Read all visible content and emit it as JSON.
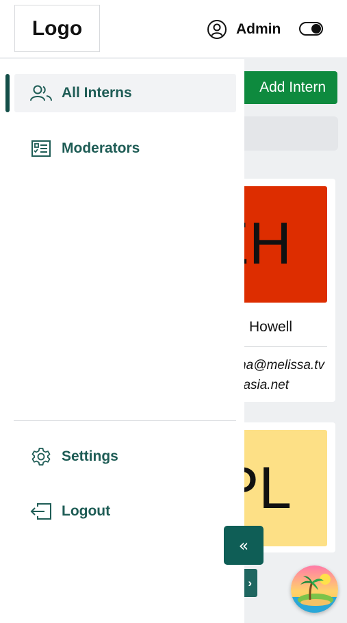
{
  "header": {
    "logo_text": "Logo",
    "user_icon": "user-circle-icon",
    "user_name": "Admin",
    "theme_toggle_icon": "toggle-icon"
  },
  "main": {
    "add_button_label": "Add Intern",
    "cards": [
      {
        "initials": "EH",
        "avatar_color": "#dd2d00",
        "name": "Ervin Howell",
        "email_line1": "Shanna@melissa.tv",
        "email_line2": "Anastasia.net"
      },
      {
        "initials": "PL",
        "avatar_color": "#fde086"
      }
    ],
    "next_page_icon": "chevron-right-icon"
  },
  "sidebar": {
    "items": [
      {
        "label": "All Interns",
        "icon": "users-icon",
        "active": true
      },
      {
        "label": "Moderators",
        "icon": "id-card-icon",
        "active": false
      }
    ],
    "bottom_items": [
      {
        "label": "Settings",
        "icon": "gear-icon"
      },
      {
        "label": "Logout",
        "icon": "logout-icon"
      }
    ],
    "collapse_label": "«",
    "collapse_icon": "double-chevron-left-icon"
  },
  "floating": {
    "icon": "beach-island-icon"
  },
  "colors": {
    "accent": "#1e5c55",
    "accent_dark": "#0f5e56",
    "add_button": "#0e8a3e"
  }
}
